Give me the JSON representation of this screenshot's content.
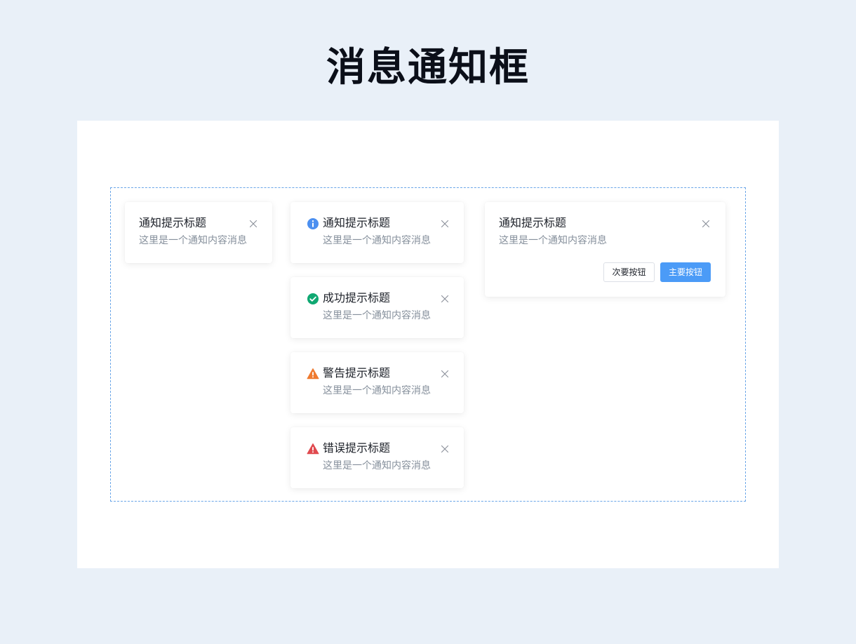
{
  "page": {
    "title": "消息通知框"
  },
  "colors": {
    "background": "#e9f0f8",
    "info": "#4b8ff0",
    "success": "#0fa872",
    "warning": "#ef7a2f",
    "error": "#e04a4f",
    "primary_button": "#4b9bf7"
  },
  "notifications": {
    "plain": {
      "title": "通知提示标题",
      "body": "这里是一个通知内容消息",
      "close_icon": "close-icon"
    },
    "info": {
      "icon": "info-icon",
      "title": "通知提示标题",
      "body": "这里是一个通知内容消息",
      "close_icon": "close-icon"
    },
    "success": {
      "icon": "check-circle-icon",
      "title": "成功提示标题",
      "body": "这里是一个通知内容消息",
      "close_icon": "close-icon"
    },
    "warning": {
      "icon": "warning-triangle-icon",
      "title": "警告提示标题",
      "body": "这里是一个通知内容消息",
      "close_icon": "close-icon"
    },
    "error": {
      "icon": "error-triangle-icon",
      "title": "错误提示标题",
      "body": "这里是一个通知内容消息",
      "close_icon": "close-icon"
    },
    "with_actions": {
      "title": "通知提示标题",
      "body": "这里是一个通知内容消息",
      "close_icon": "close-icon",
      "secondary_button": "次要按钮",
      "primary_button": "主要按钮"
    }
  }
}
